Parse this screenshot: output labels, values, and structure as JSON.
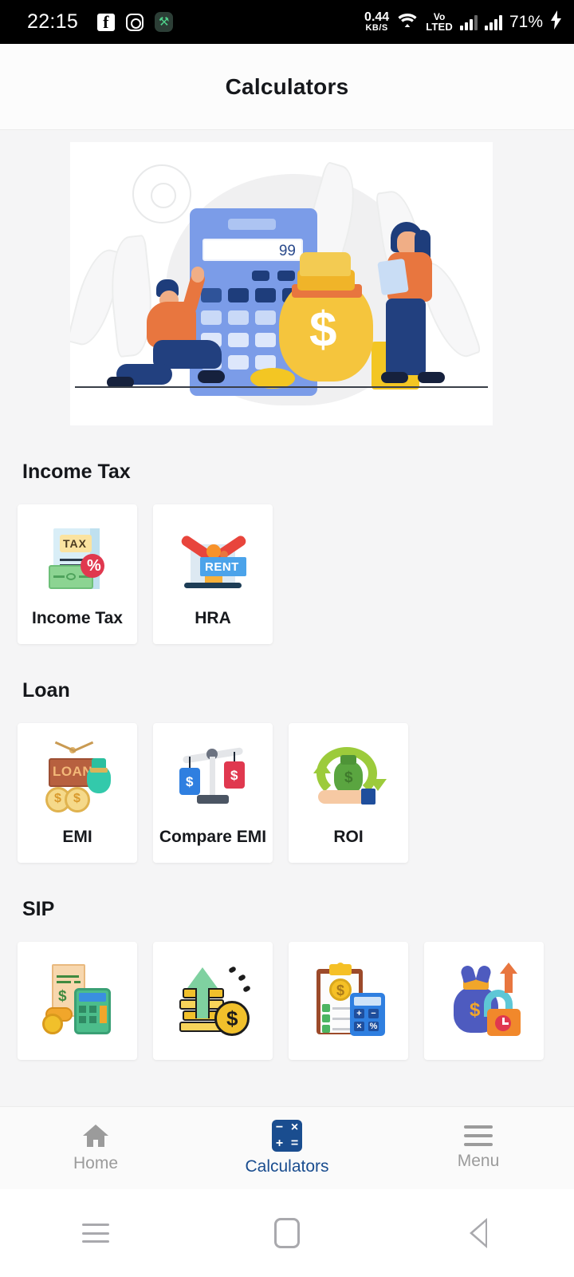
{
  "status_bar": {
    "time": "22:15",
    "left_icons": [
      "facebook-icon",
      "instagram-icon",
      "app-icon"
    ],
    "network_speed_value": "0.44",
    "network_speed_unit": "KB/S",
    "wifi_icon": "wifi-icon",
    "volte_line1": "Vo",
    "volte_line2": "LTED",
    "signal_icons": [
      "signal-bars-sim1",
      "signal-bars-sim2"
    ],
    "battery_percent": "71%",
    "charging_icon": "charging-bolt-icon"
  },
  "header": {
    "title": "Calculators"
  },
  "hero": {
    "name": "calculators-hero-illustration",
    "calculator_display_value": "99",
    "money_bag_symbol": "$",
    "colors": {
      "calculator_body": "#7b9ce8",
      "money_bag": "#f5c53d",
      "accent_orange": "#e8763f",
      "accent_navy": "#1e3d7b"
    }
  },
  "sections": [
    {
      "title": "Income Tax",
      "cards": [
        {
          "label": "Income Tax",
          "icon": "income-tax-document-icon"
        },
        {
          "label": "HRA",
          "icon": "house-rent-icon"
        }
      ]
    },
    {
      "title": "Loan",
      "cards": [
        {
          "label": "EMI",
          "icon": "loan-sign-coins-icon"
        },
        {
          "label": "Compare EMI",
          "icon": "balance-scale-icon"
        },
        {
          "label": "ROI",
          "icon": "return-on-investment-icon"
        }
      ]
    },
    {
      "title": "SIP",
      "cards": [
        {
          "label": "",
          "icon": "invoice-calculator-icon"
        },
        {
          "label": "",
          "icon": "growth-arrow-coins-icon"
        },
        {
          "label": "",
          "icon": "clipboard-calculator-icon"
        },
        {
          "label": "",
          "icon": "moneybag-lock-icon"
        }
      ]
    }
  ],
  "bottom_nav": {
    "items": [
      {
        "label": "Home",
        "icon": "home-icon",
        "active": false
      },
      {
        "label": "Calculators",
        "icon": "calculator-icon",
        "active": true
      },
      {
        "label": "Menu",
        "icon": "hamburger-menu-icon",
        "active": false
      }
    ],
    "active_color": "#1a4d8f",
    "inactive_color": "#9b9b9b"
  },
  "android_nav": {
    "recents_icon": "recents-icon",
    "home_icon": "home-pill-icon",
    "back_icon": "back-triangle-icon"
  },
  "icon_labels": {
    "tax": "TAX",
    "percent": "%",
    "rent": "RENT",
    "loan": "LOAN",
    "dollar": "$",
    "plus": "+",
    "minus": "−",
    "times": "×",
    "equals": "="
  }
}
